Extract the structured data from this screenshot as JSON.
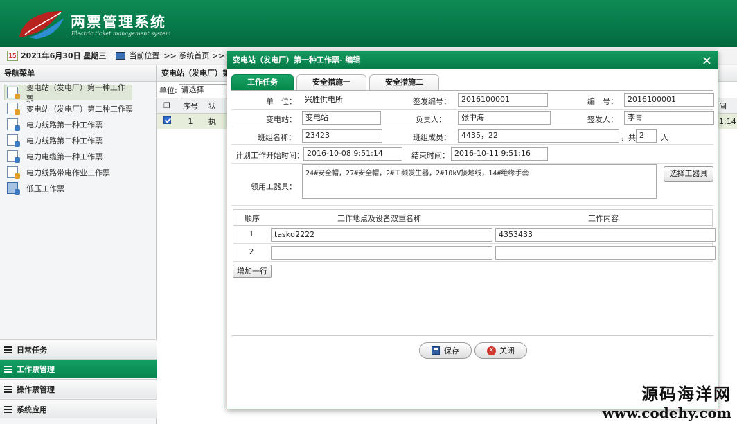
{
  "header": {
    "title": "两票管理系统",
    "subtitle": "Electric ticket management system"
  },
  "infobar": {
    "cal_day": "15",
    "date": "2021年6月30日 星期三",
    "location_label": "当前位置",
    "crumb": ">> 系统首页 >> 变"
  },
  "sidebar": {
    "title": "导航菜单",
    "items": [
      {
        "label": "变电站（发电厂）第一种工作票",
        "icon": "edit-document-icon"
      },
      {
        "label": "变电站（发电厂）第二种工作票",
        "icon": "edit-document-icon"
      },
      {
        "label": "电力线路第一种工作票",
        "icon": "document-icon"
      },
      {
        "label": "电力线路第二种工作票",
        "icon": "document-icon"
      },
      {
        "label": "电力电缆第一种工作票",
        "icon": "document-icon"
      },
      {
        "label": "电力线路带电作业工作票",
        "icon": "edit-document-icon"
      },
      {
        "label": "低压工作票",
        "icon": "stack-icon"
      }
    ],
    "menus": [
      {
        "label": "日常任务"
      },
      {
        "label": "工作票管理"
      },
      {
        "label": "操作票管理"
      },
      {
        "label": "系统应用"
      }
    ]
  },
  "main": {
    "title": "变电站（发电厂）第",
    "filter_label": "单位:",
    "filter_value": "请选择",
    "col_seq": "序号",
    "col_status": "状",
    "col_right": "间",
    "row_seq": "1",
    "row_status": "执",
    "row_right": "1:14"
  },
  "dialog": {
    "title": "变电站（发电厂）第一种工作票- 编辑",
    "close": "✕",
    "tabs": [
      "工作任务",
      "安全措施一",
      "安全措施二"
    ],
    "form": {
      "unit_label": "单　位：",
      "unit_value": "兴胜供电所",
      "issue_no_label": "签发编号：",
      "issue_no_value": "2016100001",
      "no_label": "编　号：",
      "no_value": "2016100001",
      "substation_label": "变电站：",
      "substation_value": "变电站",
      "leader_label": "负责人：",
      "leader_value": "张中海",
      "issuer_label": "签发人：",
      "issuer_value": "李青",
      "team_label": "班组名称：",
      "team_value": "23423",
      "members_label": "班组成员：",
      "members_value": "4435，22",
      "total_prefix": "，共",
      "total_value": "2",
      "total_suffix": "人",
      "start_label": "计划工作开始时间：",
      "start_value": "2016-10-08 9:51:14",
      "end_label": "结束时间：",
      "end_value": "2016-10-11 9:51:16",
      "tools_label": "领用工器具：",
      "tools_value": "24#安全帽，27#安全帽，2#工频发生器，2#10kV接地线，14#绝缘手套",
      "select_tools": "选择工器具"
    },
    "grid": {
      "col_order": "顺序",
      "col_location": "工作地点及设备双重名称",
      "col_content": "工作内容",
      "rows": [
        {
          "num": "1",
          "location": "taskd2222",
          "content": "4353433"
        },
        {
          "num": "2",
          "location": "",
          "content": ""
        }
      ],
      "add_row": "增加一行"
    },
    "save": "保存",
    "cancel": "关闭"
  },
  "watermark": {
    "line1": "源码海洋网",
    "line2": "www.codehy.com"
  }
}
